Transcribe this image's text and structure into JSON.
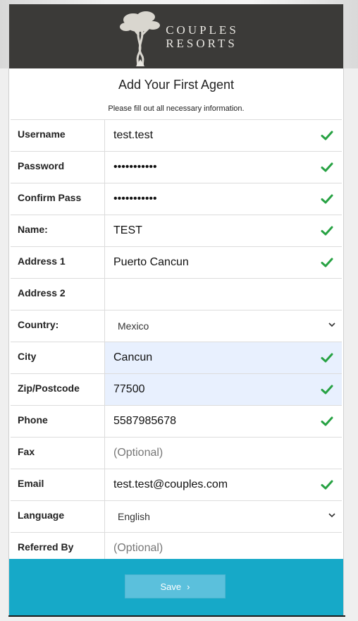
{
  "brand": {
    "line1": "COUPLES",
    "line2": "RESORTS"
  },
  "form": {
    "title": "Add Your First Agent",
    "subtitle": "Please fill out all necessary information.",
    "rows": [
      {
        "label": "Username",
        "value": "test.test",
        "valid": true
      },
      {
        "label": "Password",
        "value": "•••••••••••",
        "valid": true
      },
      {
        "label": "Confirm Pass",
        "value": "•••••••••••",
        "valid": true
      },
      {
        "label": "Name:",
        "value": "TEST",
        "valid": true
      },
      {
        "label": "Address 1",
        "value": "Puerto Cancun",
        "valid": true
      },
      {
        "label": "Address 2",
        "value": "",
        "valid": false
      },
      {
        "label": "Country:",
        "value": "Mexico",
        "type": "select"
      },
      {
        "label": "City",
        "value": "Cancun",
        "valid": true,
        "autofilled": true
      },
      {
        "label": "Zip/Postcode",
        "value": "77500",
        "valid": true,
        "autofilled": true
      },
      {
        "label": "Phone",
        "value": "5587985678",
        "valid": true
      },
      {
        "label": "Fax",
        "placeholder": "(Optional)"
      },
      {
        "label": "Email",
        "value": "test.test@couples.com",
        "valid": true
      },
      {
        "label": "Language",
        "value": "English",
        "type": "select"
      },
      {
        "label": "Referred By",
        "placeholder": "(Optional)"
      }
    ]
  },
  "save_button": {
    "label": "Save",
    "chevron": "›"
  },
  "colors": {
    "header_bg": "#3b3a38",
    "footer_bg": "#16a9c8",
    "button_bg": "#5bc0dc",
    "check": "#27a243",
    "autofill_bg": "#e8f0fe"
  }
}
